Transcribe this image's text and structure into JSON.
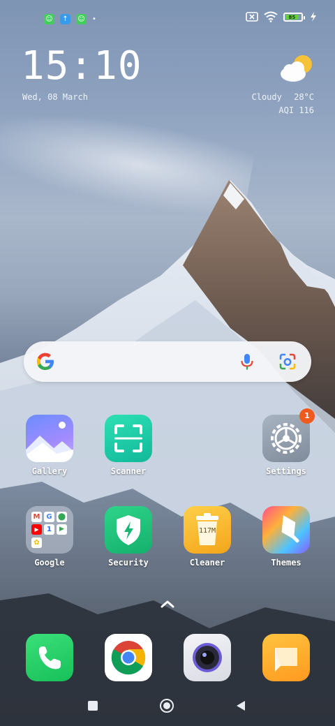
{
  "status_bar": {
    "notification_icons": [
      "android-icon",
      "upload-arrow-icon",
      "android-icon"
    ],
    "battery_level": "85",
    "icons": [
      "sim-off-icon",
      "wifi-icon",
      "battery-icon",
      "charging-icon"
    ]
  },
  "clock": {
    "time": "15:10",
    "date": "Wed, 08 March"
  },
  "weather": {
    "condition": "Cloudy",
    "temperature": "28°C",
    "aqi": "AQI 116"
  },
  "search": {
    "icons": [
      "google-icon",
      "microphone-icon",
      "lens-icon"
    ]
  },
  "apps": {
    "gallery": "Gallery",
    "scanner": "Scanner",
    "settings": "Settings",
    "settings_badge": "1",
    "google": "Google",
    "security": "Security",
    "cleaner": "Cleaner",
    "cleaner_value": "117M",
    "themes": "Themes"
  },
  "dock": [
    "phone",
    "chrome",
    "camera",
    "messages"
  ],
  "colors": {
    "accent_badge": "#ef5a1e",
    "battery_fill": "#63d13e"
  }
}
